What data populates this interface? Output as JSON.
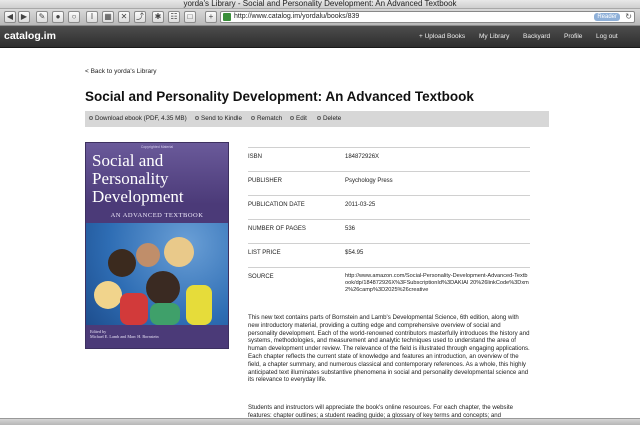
{
  "window": {
    "title": "yorda's Library - Social and Personality Development: An Advanced Textbook"
  },
  "toolbar": {
    "url": "http://www.catalog.im/yordalu/books/839",
    "reader_label": "Reader"
  },
  "site": {
    "brand": "catalog.im",
    "nav": [
      "+ Upload Books",
      "My Library",
      "Backyard",
      "Profile",
      "Log out"
    ]
  },
  "page": {
    "back_link": "< Back to yorda's Library",
    "book_title": "Social and Personality Development: An Advanced Textbook",
    "actions": [
      "Download ebook (PDF, 4.35 MB)",
      "Send to Kindle",
      "Rematch",
      "Edit",
      "Delete"
    ]
  },
  "cover": {
    "top_text": "Copyrighted Material",
    "title_lines": [
      "Social and",
      "Personality",
      "Development"
    ],
    "subtitle": "AN ADVANCED TEXTBOOK",
    "credits_line1": "Edited by",
    "credits_line2": "Michael E. Lamb and Marc H. Bornstein"
  },
  "details": [
    {
      "key": "ISBN",
      "value": "184872926X"
    },
    {
      "key": "PUBLISHER",
      "value": "Psychology Press"
    },
    {
      "key": "PUBLICATION DATE",
      "value": "2011-03-25"
    },
    {
      "key": "NUMBER OF PAGES",
      "value": "536"
    },
    {
      "key": "LIST PRICE",
      "value": "$54.95"
    },
    {
      "key": "SOURCE",
      "value": "http://www.amazon.com/Social-Personality-Development-Advanced-Textbook/dp/184872926X%3FSubscriptionId%3DAKIAI 20%26linkCode%3Dxm2%26camp%3D2025%26creative"
    }
  ],
  "description": "This new text contains parts of Bornstein and Lamb's Developmental Science, 6th edition, along with new introductory material, providing a cutting edge and comprehensive overview of social and personality development. Each of the world-renowned contributors masterfully introduces the history and systems, methodologies, and measurement and analytic techniques used to understand the area of human development under review. The relevance of the field is illustrated through engaging applications. Each chapter reflects the current state of knowledge and features an introduction, an overview of the field, a chapter summary, and numerous classical and contemporary references. As a whole, this highly anticipated text illuminates substantive phenomena in social and personality developmental science and its relevance to everyday life.",
  "description2": "Students and instructors will appreciate the book's online resources. For each chapter, the website features: chapter outlines; a student reading guide; a glossary of key terms and concepts; and suggested readings with links to journal articles. Only"
}
